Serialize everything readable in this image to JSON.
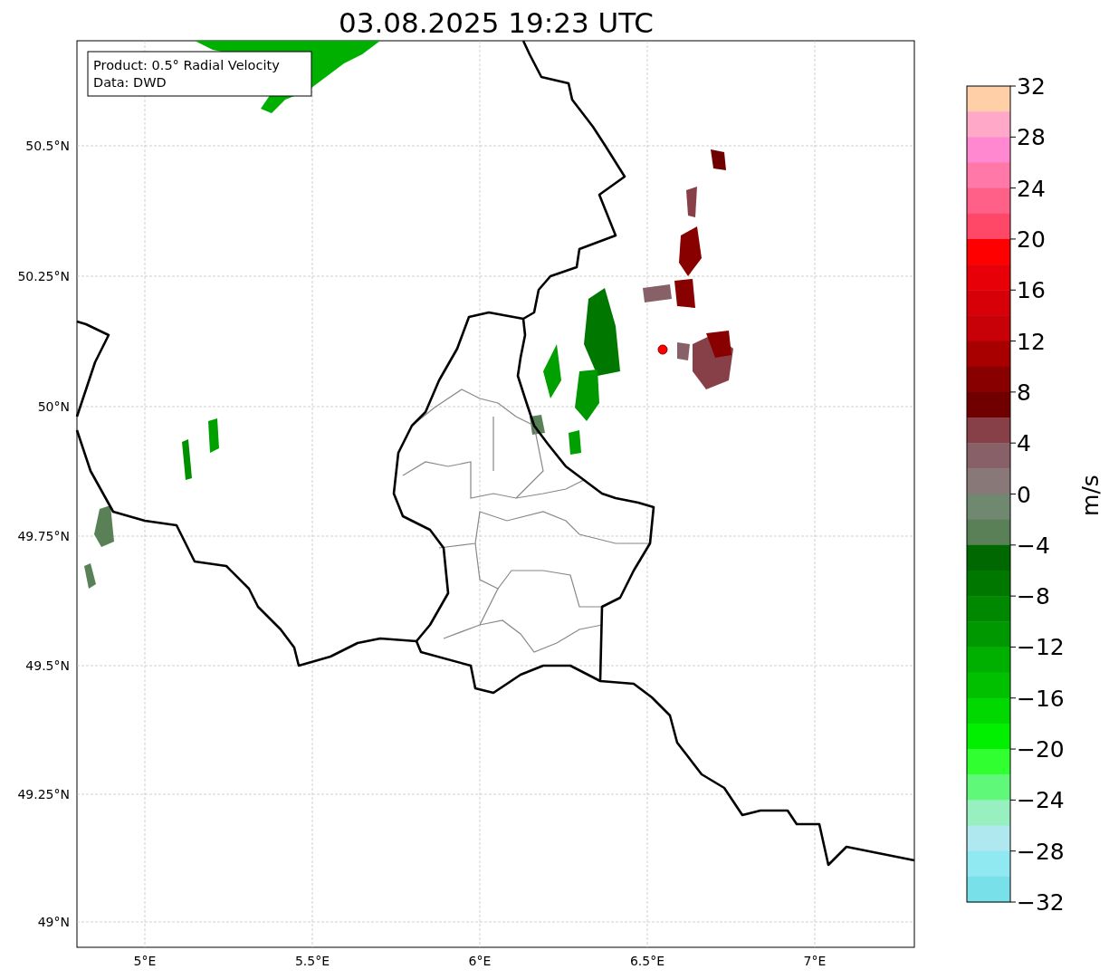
{
  "title": "03.08.2025 19:23 UTC",
  "info_box": [
    "Product: 0.5° Radial Velocity",
    "Data: DWD"
  ],
  "map": {
    "lat_labels": [
      "50.5°N",
      "50.25°N",
      "50°N",
      "49.75°N",
      "49.5°N",
      "49.25°N",
      "49°N"
    ],
    "lon_labels": [
      "5°E",
      "5.5°E",
      "6°E",
      "6.5°E",
      "7°E"
    ]
  },
  "colorbar": {
    "label": "m/s",
    "ticks": [
      "32",
      "28",
      "24",
      "20",
      "16",
      "12",
      "8",
      "4",
      "0",
      "−4",
      "−8",
      "−12",
      "−16",
      "−20",
      "−24",
      "−28",
      "−32"
    ],
    "segments": [
      {
        "color": "#ffcfa8"
      },
      {
        "color": "#ffa8c8"
      },
      {
        "color": "#ff88d0"
      },
      {
        "color": "#ff78a8"
      },
      {
        "color": "#ff6088"
      },
      {
        "color": "#ff4868"
      },
      {
        "color": "#ff0000"
      },
      {
        "color": "#e80008"
      },
      {
        "color": "#d80008"
      },
      {
        "color": "#c80008"
      },
      {
        "color": "#a80000"
      },
      {
        "color": "#880000"
      },
      {
        "color": "#700000"
      },
      {
        "color": "#884048"
      },
      {
        "color": "#886068"
      },
      {
        "color": "#887878"
      },
      {
        "color": "#708870"
      },
      {
        "color": "#5a8058"
      },
      {
        "color": "#006800"
      },
      {
        "color": "#007800"
      },
      {
        "color": "#008800"
      },
      {
        "color": "#009800"
      },
      {
        "color": "#00b000"
      },
      {
        "color": "#00c000"
      },
      {
        "color": "#00d800"
      },
      {
        "color": "#00f000"
      },
      {
        "color": "#30ff30"
      },
      {
        "color": "#60f878"
      },
      {
        "color": "#98f0c0"
      },
      {
        "color": "#b0e8f0"
      },
      {
        "color": "#90e8f0"
      },
      {
        "color": "#78e0e8"
      }
    ]
  }
}
